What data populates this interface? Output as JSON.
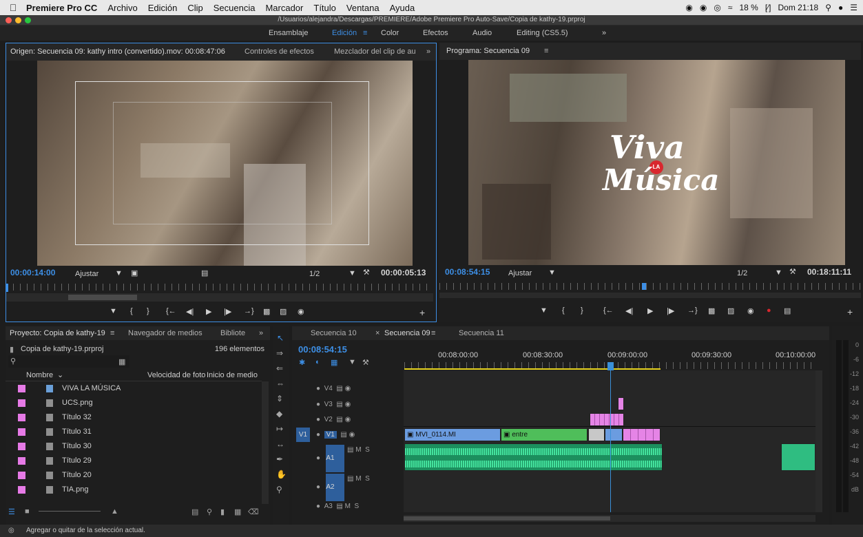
{
  "menubar": {
    "app": "Premiere Pro CC",
    "items": [
      "Archivo",
      "Edición",
      "Clip",
      "Secuencia",
      "Marcador",
      "Título",
      "Ventana",
      "Ayuda"
    ],
    "battery": "18 %",
    "clock": "Dom 21:18"
  },
  "titlebar": {
    "path": "/Usuarios/alejandra/Descargas/PREMIERE/Adobe Premiere Pro Auto-Save/Copia de kathy-19.prproj"
  },
  "workspaces": {
    "items": [
      "Ensamblaje",
      "Edición",
      "Color",
      "Efectos",
      "Audio",
      "Editing (CS5.5)"
    ],
    "active": "Edición"
  },
  "source": {
    "tabs": [
      "Origen: Secuencia 09: kathy intro (convertido).mov: 00:08:47:06",
      "Controles de efectos",
      "Mezclador del clip de au"
    ],
    "timecode": "00:00:14:00",
    "fit": "Ajustar",
    "resolution": "1/2",
    "duration": "00:00:05:13"
  },
  "program": {
    "tab": "Programa: Secuencia 09",
    "timecode": "00:08:54:15",
    "fit": "Ajustar",
    "resolution": "1/2",
    "duration": "00:18:11:11",
    "logo_top": "Viva",
    "logo_la": "LA",
    "logo_bottom": "Música"
  },
  "project": {
    "tabs": [
      "Proyecto: Copia de kathy-19",
      "Navegador de medios",
      "Bibliote"
    ],
    "file": "Copia de kathy-19.prproj",
    "count": "196 elementos",
    "columns": [
      "Nombre",
      "Velocidad de foto",
      "Inicio de medio"
    ],
    "items": [
      {
        "name": "VIVA LA MÚSICA",
        "type": "seq"
      },
      {
        "name": "UCS.png",
        "type": "img"
      },
      {
        "name": "Título 32",
        "type": "img"
      },
      {
        "name": "Título 31",
        "type": "img"
      },
      {
        "name": "Título 30",
        "type": "img"
      },
      {
        "name": "Título 29",
        "type": "img"
      },
      {
        "name": "Título 20",
        "type": "img"
      },
      {
        "name": "TIA.png",
        "type": "img"
      }
    ]
  },
  "timeline": {
    "tabs": [
      "Secuencia 10",
      "Secuencia 09",
      "Secuencia 11"
    ],
    "active": "Secuencia 09",
    "timecode": "00:08:54:15",
    "ruler": [
      "00:08:00:00",
      "00:08:30:00",
      "00:09:00:00",
      "00:09:30:00",
      "00:10:00:00"
    ],
    "tracks": [
      "V4",
      "V3",
      "V2",
      "V1",
      "A1",
      "A2",
      "A3"
    ],
    "source_v": "V1",
    "clips": {
      "c1": "MVI_0114.MI",
      "c2": "entre"
    }
  },
  "meter": {
    "marks": [
      "0",
      "-6",
      "-12",
      "-18",
      "-24",
      "-30",
      "-36",
      "-42",
      "-48",
      "-54",
      "dB"
    ]
  },
  "status": {
    "text": "Agregar o quitar de la selección actual."
  },
  "colors": {
    "accent": "#3d8fe6",
    "clip_video": "#6b9ce0",
    "clip_green": "#4fbe5a",
    "clip_pink": "#e584e6",
    "audio": "#2fbd81",
    "playhead": "#3a90d9"
  }
}
